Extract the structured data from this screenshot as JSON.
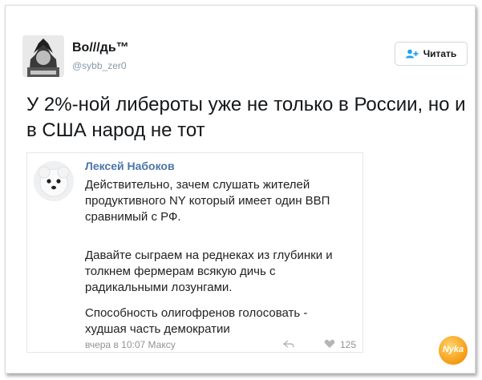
{
  "tweet": {
    "display_name": "Во///дь™",
    "handle": "@sybb_zer0",
    "follow_label": "Читать",
    "text": "У 2%-ной либероты уже не только в России, но и в США народ не тот"
  },
  "embedded_post": {
    "author": "Лексей Набоков",
    "paragraphs": [
      "Действительно, зачем слушать жителей продуктивного NY который имеет один ВВП сравнимый с РФ.",
      "Давайте сыграем на реднеках из глубинки и толкнем фермерам всякую дичь с радикальными лозунгами.",
      "Способность олигофренов голосовать - худшая часть демократии"
    ],
    "meta": "вчера в 10:07 Максу",
    "likes": "125"
  },
  "watermark": "Nyka",
  "colors": {
    "link_blue": "#4a76a8",
    "follow_icon": "#1da1f2",
    "watermark": "#f59a12"
  }
}
